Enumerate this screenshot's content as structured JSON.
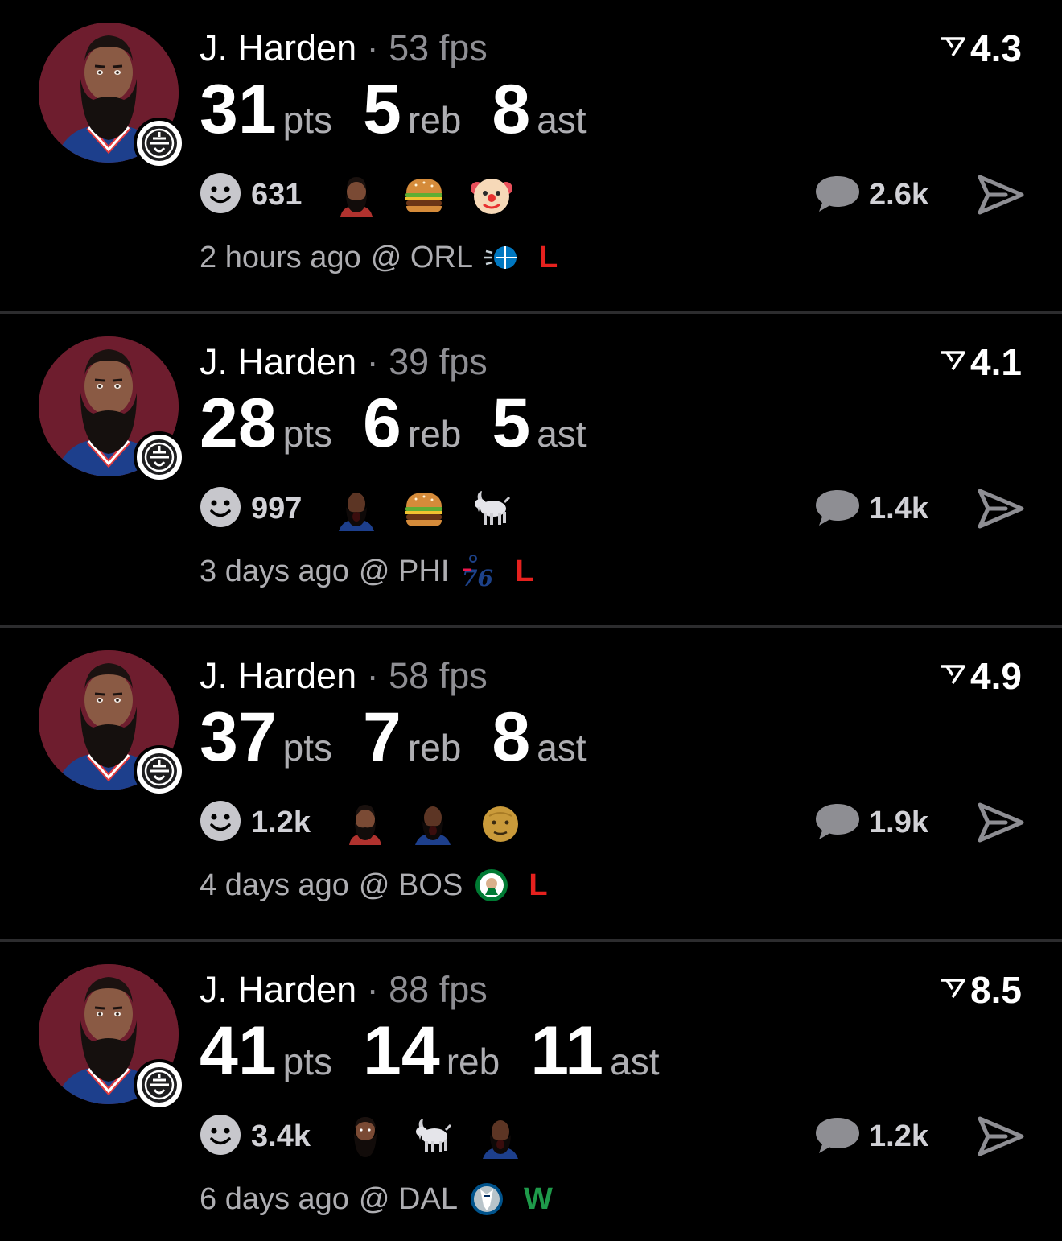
{
  "colors": {
    "loss": "#e5211e",
    "win": "#1e9a4a",
    "muted": "#8e8e93",
    "avatar_bg": "#6e1d2e"
  },
  "posts": [
    {
      "player": "J. Harden",
      "separator": "·",
      "fps": "53 fps",
      "rating": "4.3",
      "stats": [
        {
          "num": "31",
          "unit": "pts"
        },
        {
          "num": "5",
          "unit": "reb"
        },
        {
          "num": "8",
          "unit": "ast"
        }
      ],
      "reaction_count": "631",
      "reaction_emojis": [
        "harden-face-emoji",
        "burger-emoji",
        "clown-emoji"
      ],
      "comment_count": "2.6k",
      "time": "2 hours ago",
      "opponent": "@ ORL",
      "team_logo": "orl-logo-icon",
      "result": "L"
    },
    {
      "player": "J. Harden",
      "separator": "·",
      "fps": "39 fps",
      "rating": "4.1",
      "stats": [
        {
          "num": "28",
          "unit": "pts"
        },
        {
          "num": "6",
          "unit": "reb"
        },
        {
          "num": "5",
          "unit": "ast"
        }
      ],
      "reaction_count": "997",
      "reaction_emojis": [
        "harden-yell-emoji",
        "burger-emoji",
        "goat-emoji"
      ],
      "comment_count": "1.4k",
      "time": "3 days ago",
      "opponent": "@ PHI",
      "team_logo": "phi-logo-icon",
      "result": "L"
    },
    {
      "player": "J. Harden",
      "separator": "·",
      "fps": "58 fps",
      "rating": "4.9",
      "stats": [
        {
          "num": "37",
          "unit": "pts"
        },
        {
          "num": "7",
          "unit": "reb"
        },
        {
          "num": "8",
          "unit": "ast"
        }
      ],
      "reaction_count": "1.2k",
      "reaction_emojis": [
        "harden-face-emoji",
        "harden-yell-emoji",
        "old-man-emoji"
      ],
      "comment_count": "1.9k",
      "time": "4 days ago",
      "opponent": "@ BOS",
      "team_logo": "bos-logo-icon",
      "result": "L"
    },
    {
      "player": "J. Harden",
      "separator": "·",
      "fps": "88 fps",
      "rating": "8.5",
      "stats": [
        {
          "num": "41",
          "unit": "pts"
        },
        {
          "num": "14",
          "unit": "reb"
        },
        {
          "num": "11",
          "unit": "ast"
        }
      ],
      "reaction_count": "3.4k",
      "reaction_emojis": [
        "harden-head-emoji",
        "goat-emoji",
        "harden-yell-emoji"
      ],
      "comment_count": "1.2k",
      "time": "6 days ago",
      "opponent": "@ DAL",
      "team_logo": "dal-logo-icon",
      "result": "W"
    }
  ]
}
